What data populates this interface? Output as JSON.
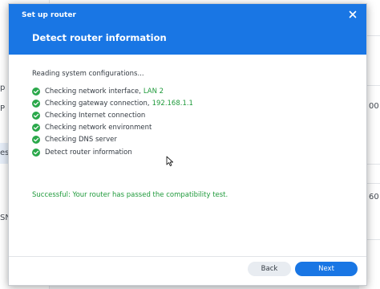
{
  "background": {
    "sidebar_fragments": [
      "p",
      "P",
      "ess",
      "SNM"
    ],
    "right_fragments": [
      "00",
      "60"
    ]
  },
  "dialog": {
    "window_title": "Set up router",
    "heading": "Detect router information",
    "intro": "Reading system configurations...",
    "checks": [
      {
        "label": "Checking network interface,",
        "value": "LAN 2"
      },
      {
        "label": "Checking gateway connection,",
        "value": "192.168.1.1"
      },
      {
        "label": "Checking Internet connection",
        "value": ""
      },
      {
        "label": "Checking network environment",
        "value": ""
      },
      {
        "label": "Checking DNS server",
        "value": ""
      },
      {
        "label": "Detect router information",
        "value": ""
      }
    ],
    "success_message": "Successful: Your router has passed the compatibility test.",
    "buttons": {
      "back": "Back",
      "next": "Next"
    }
  },
  "colors": {
    "header_blue": "#1976e4",
    "success_green": "#1f9a3b",
    "check_icon_green": "#2aa84a"
  },
  "icons": {
    "close": "close-icon",
    "check": "check-circle-icon",
    "cursor": "mouse-cursor-icon"
  }
}
